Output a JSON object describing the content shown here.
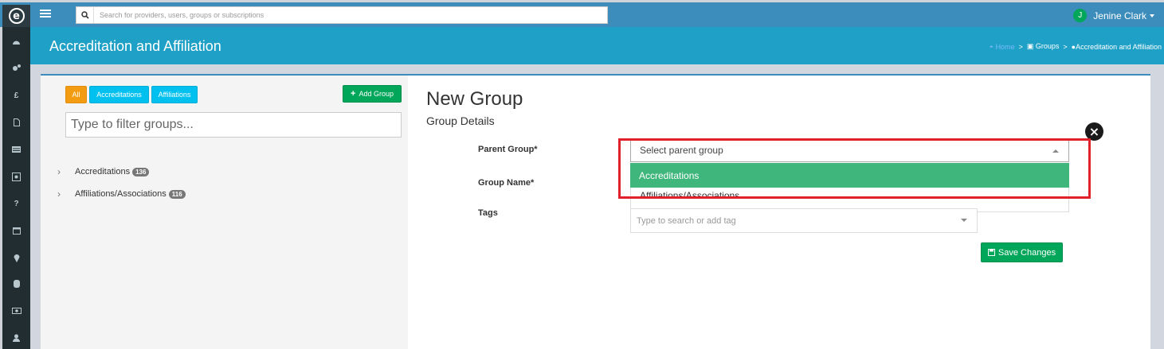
{
  "topbar": {
    "logo_letter": "e",
    "search_placeholder": "Search for providers, users, groups or subscriptions",
    "user_initial": "J",
    "user_name": "Jenine Clark"
  },
  "sidebar": {
    "items": [
      "dashboard-icon",
      "settings-icon",
      "£",
      "document-icon",
      "list-icon",
      "groups-icon",
      "?",
      "calendar-icon",
      "map-marker-icon",
      "database-icon",
      "money-icon",
      "user-icon"
    ]
  },
  "header": {
    "title": "Accreditation and Affiliation",
    "breadcrumb": {
      "home": "Home",
      "sep": ">",
      "groups": "Groups",
      "current": "Accreditation and Affiliation"
    }
  },
  "left_panel": {
    "filter_buttons": [
      "All",
      "Accreditations",
      "Affiliations"
    ],
    "add_group_label": "Add Group",
    "filter_placeholder": "Type to filter groups...",
    "tree": [
      {
        "label": "Accreditations",
        "count": "136"
      },
      {
        "label": "Affiliations/Associations",
        "count": "116"
      }
    ]
  },
  "form": {
    "title": "New Group",
    "subtitle": "Group Details",
    "labels": {
      "parent_group": "Parent Group*",
      "group_name": "Group Name*",
      "tags": "Tags"
    },
    "parent_select": {
      "placeholder": "Select parent group",
      "options": [
        "Accreditations",
        "Affiliations/Associations"
      ],
      "highlighted": "Accreditations"
    },
    "tags_placeholder": "Type to search or add tag",
    "save_label": "Save Changes"
  },
  "colors": {
    "topbar": "#3c8dbc",
    "banner": "#1fa0c6",
    "sidebar": "#222d32",
    "highlight": "#3fb67c",
    "annotation": "#e0202a"
  }
}
